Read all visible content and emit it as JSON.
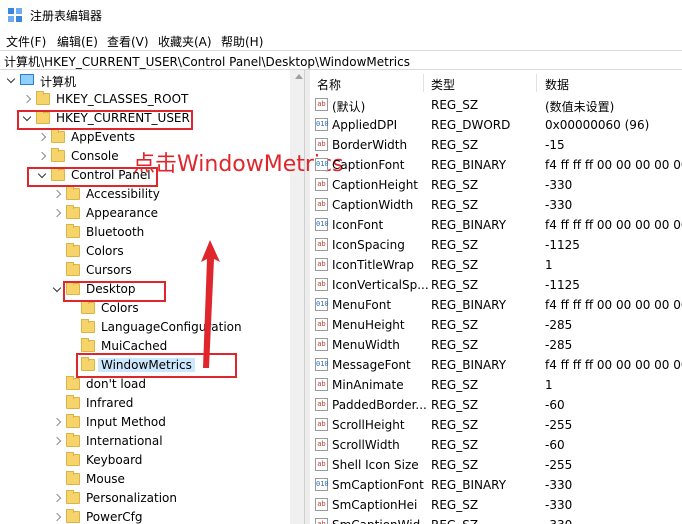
{
  "window": {
    "title": "注册表编辑器"
  },
  "menu": [
    "文件(F)",
    "编辑(E)",
    "查看(V)",
    "收藏夹(A)",
    "帮助(H)"
  ],
  "address": "计算机\\HKEY_CURRENT_USER\\Control Panel\\Desktop\\WindowMetrics",
  "tree": {
    "root": "计算机",
    "hkcr": "HKEY_CLASSES_ROOT",
    "hkcu": "HKEY_CURRENT_USER",
    "appevents": "AppEvents",
    "console": "Console",
    "control_panel": "Control Panel",
    "accessibility": "Accessibility",
    "appearance": "Appearance",
    "bluetooth": "Bluetooth",
    "colors": "Colors",
    "cursors": "Cursors",
    "desktop": "Desktop",
    "desktop_colors": "Colors",
    "language_configuration": "LanguageConfiguration",
    "mui_cached": "MuiCached",
    "window_metrics": "WindowMetrics",
    "dont_load": "don't load",
    "infrared": "Infrared",
    "input_method": "Input Method",
    "international": "International",
    "keyboard": "Keyboard",
    "mouse": "Mouse",
    "personalization": "Personalization",
    "powercfg": "PowerCfg"
  },
  "annotation": "点击WindowMetrics",
  "columns": {
    "name": "名称",
    "type": "类型",
    "data": "数据"
  },
  "values": [
    {
      "name": "(默认)",
      "type": "REG_SZ",
      "data": "(数值未设置)",
      "icon": "ab"
    },
    {
      "name": "AppliedDPI",
      "type": "REG_DWORD",
      "data": "0x00000060 (96)",
      "icon": "010"
    },
    {
      "name": "BorderWidth",
      "type": "REG_SZ",
      "data": "-15",
      "icon": "ab"
    },
    {
      "name": "CaptionFont",
      "type": "REG_BINARY",
      "data": "f4 ff ff ff 00 00 00 00 00 00 0",
      "icon": "010"
    },
    {
      "name": "CaptionHeight",
      "type": "REG_SZ",
      "data": "-330",
      "icon": "ab"
    },
    {
      "name": "CaptionWidth",
      "type": "REG_SZ",
      "data": "-330",
      "icon": "ab"
    },
    {
      "name": "IconFont",
      "type": "REG_BINARY",
      "data": "f4 ff ff ff 00 00 00 00 00 00 0",
      "icon": "010"
    },
    {
      "name": "IconSpacing",
      "type": "REG_SZ",
      "data": "-1125",
      "icon": "ab"
    },
    {
      "name": "IconTitleWrap",
      "type": "REG_SZ",
      "data": "1",
      "icon": "ab"
    },
    {
      "name": "IconVerticalSp...",
      "type": "REG_SZ",
      "data": "-1125",
      "icon": "ab"
    },
    {
      "name": "MenuFont",
      "type": "REG_BINARY",
      "data": "f4 ff ff ff 00 00 00 00 00 00 0",
      "icon": "010"
    },
    {
      "name": "MenuHeight",
      "type": "REG_SZ",
      "data": "-285",
      "icon": "ab"
    },
    {
      "name": "MenuWidth",
      "type": "REG_SZ",
      "data": "-285",
      "icon": "ab"
    },
    {
      "name": "MessageFont",
      "type": "REG_BINARY",
      "data": "f4 ff ff ff 00 00 00 00 00 00 0",
      "icon": "010"
    },
    {
      "name": "MinAnimate",
      "type": "REG_SZ",
      "data": "1",
      "icon": "ab"
    },
    {
      "name": "PaddedBorder...",
      "type": "REG_SZ",
      "data": "-60",
      "icon": "ab"
    },
    {
      "name": "ScrollHeight",
      "type": "REG_SZ",
      "data": "-255",
      "icon": "ab"
    },
    {
      "name": "ScrollWidth",
      "type": "REG_SZ",
      "data": "-60",
      "icon": "ab"
    },
    {
      "name": "Shell Icon Size",
      "type": "REG_SZ",
      "data": "-255",
      "icon": "ab"
    },
    {
      "name": "SmCaptionFont",
      "type": "REG_BINARY",
      "data": "-330",
      "icon": "010"
    },
    {
      "name": "SmCaptionHei",
      "type": "REG_SZ",
      "data": "-330",
      "icon": "ab"
    },
    {
      "name": "SmCaptionWid",
      "type": "REG_SZ",
      "data": "-330",
      "icon": "ab"
    }
  ]
}
